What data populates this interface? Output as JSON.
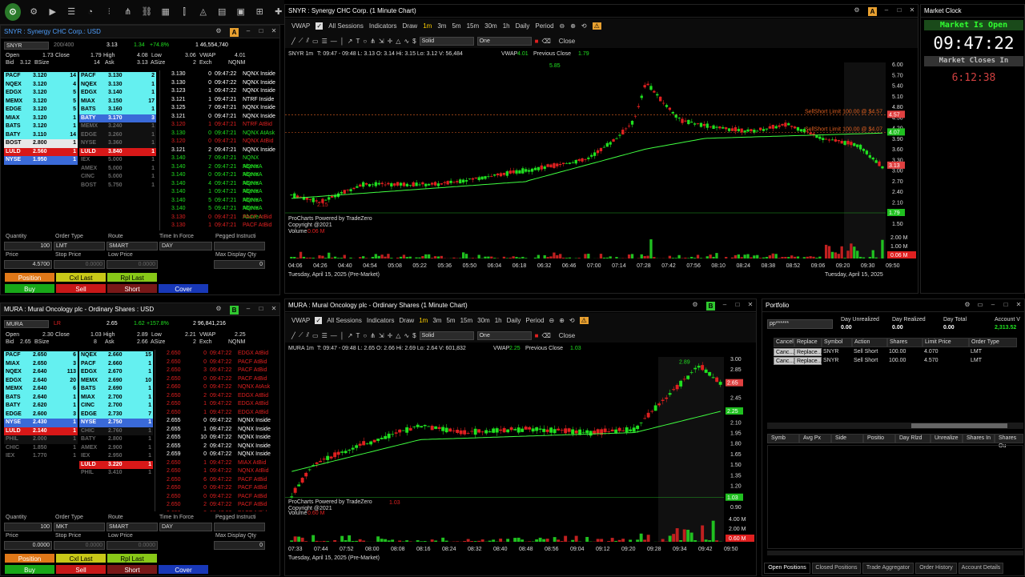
{
  "snyr_quote": {
    "title": "SNYR : Synergy CHC Corp.: USD",
    "symbol": "SNYR",
    "level_label": "200/400",
    "last": "3.13",
    "change": "1.34",
    "change_pct": "+74.8%",
    "volume": "1 46,554,740",
    "open_label": "Open",
    "open": "1.73",
    "close_label": "Close",
    "close": "1.79",
    "high_label": "High",
    "high": "4.08",
    "low_label": "Low",
    "low": "3.06",
    "vwap_label": "VWAP",
    "vwap": "4.01",
    "bid_label": "Bid",
    "bid": "3.12",
    "bsize_label": "BSize",
    "bsize": "14",
    "ask_label": "Ask",
    "ask": "3.13",
    "asize_label": "ASize",
    "asize": "2",
    "exch_label": "Exch",
    "exch": "NQNM",
    "bids": [
      {
        "mm": "PACF",
        "price": "3.120",
        "size": "14",
        "bg": "#64f0f0",
        "fg": "#000"
      },
      {
        "mm": "NQEX",
        "price": "3.120",
        "size": "4",
        "bg": "#64f0f0",
        "fg": "#000"
      },
      {
        "mm": "EDGX",
        "price": "3.120",
        "size": "5",
        "bg": "#64f0f0",
        "fg": "#000"
      },
      {
        "mm": "MEMX",
        "price": "3.120",
        "size": "5",
        "bg": "#64f0f0",
        "fg": "#000"
      },
      {
        "mm": "EDGE",
        "price": "3.120",
        "size": "5",
        "bg": "#64f0f0",
        "fg": "#000"
      },
      {
        "mm": "MIAX",
        "price": "3.120",
        "size": "1",
        "bg": "#64f0f0",
        "fg": "#000"
      },
      {
        "mm": "BATS",
        "price": "3.120",
        "size": "1",
        "bg": "#64f0f0",
        "fg": "#000"
      },
      {
        "mm": "BATY",
        "price": "3.110",
        "size": "14",
        "bg": "#64f0f0",
        "fg": "#000"
      },
      {
        "mm": "BOST",
        "price": "2.800",
        "size": "1",
        "bg": "#e8e8e8",
        "fg": "#000"
      },
      {
        "mm": "LULD",
        "price": "2.560",
        "size": "1",
        "bg": "#d81818",
        "fg": "#fff"
      },
      {
        "mm": "NYSE",
        "price": "1.950",
        "size": "1",
        "bg": "#3a6ad8",
        "fg": "#fff"
      }
    ],
    "asks": [
      {
        "mm": "PACF",
        "price": "3.130",
        "size": "2",
        "bg": "#64f0f0",
        "fg": "#000"
      },
      {
        "mm": "NQEX",
        "price": "3.130",
        "size": "1",
        "bg": "#64f0f0",
        "fg": "#000"
      },
      {
        "mm": "EDGX",
        "price": "3.140",
        "size": "1",
        "bg": "#64f0f0",
        "fg": "#000"
      },
      {
        "mm": "MIAX",
        "price": "3.150",
        "size": "17",
        "bg": "#64f0f0",
        "fg": "#000"
      },
      {
        "mm": "BATS",
        "price": "3.160",
        "size": "1",
        "bg": "#64f0f0",
        "fg": "#000"
      },
      {
        "mm": "BATY",
        "price": "3.170",
        "size": "3",
        "bg": "#3a6ad8",
        "fg": "#fff"
      },
      {
        "mm": "MEMX",
        "price": "3.240",
        "size": "1",
        "bg": "#111",
        "fg": "#666"
      },
      {
        "mm": "EDGE",
        "price": "3.260",
        "size": "1",
        "bg": "#111",
        "fg": "#666"
      },
      {
        "mm": "NYSE",
        "price": "3.360",
        "size": "1",
        "bg": "#111",
        "fg": "#666"
      },
      {
        "mm": "LULD",
        "price": "3.840",
        "size": "1",
        "bg": "#d81818",
        "fg": "#fff"
      },
      {
        "mm": "IEX",
        "price": "5.000",
        "size": "1",
        "bg": "#000",
        "fg": "#666"
      },
      {
        "mm": "AMEX",
        "price": "5.000",
        "size": "1",
        "bg": "#000",
        "fg": "#666"
      },
      {
        "mm": "CINC",
        "price": "5.000",
        "size": "1",
        "bg": "#000",
        "fg": "#666"
      },
      {
        "mm": "BOST",
        "price": "5.750",
        "size": "1",
        "bg": "#000",
        "fg": "#666"
      }
    ],
    "tas": [
      {
        "p": "3.130",
        "s": "0",
        "t": "09:47:22",
        "x": "NQNX Inside",
        "c": "#fff"
      },
      {
        "p": "3.130",
        "s": "0",
        "t": "09:47:22",
        "x": "NQNX Inside",
        "c": "#fff"
      },
      {
        "p": "3.123",
        "s": "1",
        "t": "09:47:22",
        "x": "NQNX Inside",
        "c": "#fff"
      },
      {
        "p": "3.121",
        "s": "1",
        "t": "09:47:21",
        "x": "NTRF Inside",
        "c": "#fff"
      },
      {
        "p": "3.125",
        "s": "7",
        "t": "09:47:21",
        "x": "NQNX Inside",
        "c": "#fff"
      },
      {
        "p": "3.121",
        "s": "0",
        "t": "09:47:21",
        "x": "NQNX Inside",
        "c": "#fff"
      },
      {
        "p": "3.120",
        "s": "1",
        "t": "09:47:21",
        "x": "NTRF AtBid",
        "c": "#e02020"
      },
      {
        "p": "3.130",
        "s": "0",
        "t": "09:47:21",
        "x": "NQNX AtAsk",
        "c": "#20e020"
      },
      {
        "p": "3.120",
        "s": "0",
        "t": "09:47:21",
        "x": "NQNX AtBid",
        "c": "#e02020"
      },
      {
        "p": "3.121",
        "s": "2",
        "t": "09:47:21",
        "x": "NQNX Inside",
        "c": "#fff"
      },
      {
        "p": "3.140",
        "s": "7",
        "t": "09:47:21",
        "x": "NQNX AboveA",
        "c": "#20e020"
      },
      {
        "p": "3.140",
        "s": "2",
        "t": "09:47:21",
        "x": "NQNX AboveA",
        "c": "#20e020"
      },
      {
        "p": "3.140",
        "s": "0",
        "t": "09:47:21",
        "x": "NQNX AboveA",
        "c": "#20e020"
      },
      {
        "p": "3.140",
        "s": "4",
        "t": "09:47:21",
        "x": "NQNX AboveA",
        "c": "#20e020"
      },
      {
        "p": "3.140",
        "s": "1",
        "t": "09:47:21",
        "x": "NQNX AboveA",
        "c": "#20e020"
      },
      {
        "p": "3.140",
        "s": "5",
        "t": "09:47:21",
        "x": "NQNX AboveA",
        "c": "#20e020"
      },
      {
        "p": "3.140",
        "s": "5",
        "t": "09:47:21",
        "x": "NQNX AboveA",
        "c": "#20e020"
      },
      {
        "p": "3.130",
        "s": "0",
        "t": "09:47:21",
        "x": "PACF AtBid",
        "c": "#e02020"
      },
      {
        "p": "3.130",
        "s": "1",
        "t": "09:47:21",
        "x": "PACF AtBid",
        "c": "#e02020"
      }
    ],
    "order": {
      "qty_label": "Quantity",
      "qty": "100",
      "otype_label": "Order Type",
      "otype": "LMT",
      "route_label": "Route",
      "route": "SMART",
      "tif_label": "Time In Force",
      "tif": "DAY",
      "pegged_label": "Pegged Instructi",
      "price_label": "Price",
      "price": "4.5700",
      "stop_label": "Stop Price",
      "stop": "0.0000",
      "low_label": "Low Price",
      "low": "0.0000",
      "maxdisp_label": "Max Display Qty",
      "maxdisp": "0"
    }
  },
  "mura_quote": {
    "title": "MURA : Mural Oncology plc - Ordinary Shares : USD",
    "symbol": "MURA",
    "level_label": "LR",
    "last": "2.65",
    "change": "1.62",
    "change_pct": "+157.8%",
    "volume": "2 96,841,216",
    "open_label": "Open",
    "open": "2.30",
    "close_label": "Close",
    "close": "1.03",
    "high_label": "High",
    "high": "2.89",
    "low_label": "Low",
    "low": "2.21",
    "vwap_label": "VWAP",
    "vwap": "2.25",
    "bid_label": "Bid",
    "bid": "2.65",
    "bsize_label": "BSize",
    "bsize": "8",
    "ask_label": "Ask",
    "ask": "2.66",
    "asize_label": "ASize",
    "asize": "2",
    "exch_label": "Exch",
    "exch": "NQNM",
    "bids": [
      {
        "mm": "PACF",
        "price": "2.650",
        "size": "6",
        "bg": "#64f0f0",
        "fg": "#000"
      },
      {
        "mm": "MIAX",
        "price": "2.650",
        "size": "3",
        "bg": "#64f0f0",
        "fg": "#000"
      },
      {
        "mm": "NQEX",
        "price": "2.640",
        "size": "113",
        "bg": "#64f0f0",
        "fg": "#000"
      },
      {
        "mm": "EDGX",
        "price": "2.640",
        "size": "20",
        "bg": "#64f0f0",
        "fg": "#000"
      },
      {
        "mm": "MEMX",
        "price": "2.640",
        "size": "6",
        "bg": "#64f0f0",
        "fg": "#000"
      },
      {
        "mm": "BATS",
        "price": "2.640",
        "size": "1",
        "bg": "#64f0f0",
        "fg": "#000"
      },
      {
        "mm": "BATY",
        "price": "2.620",
        "size": "1",
        "bg": "#64f0f0",
        "fg": "#000"
      },
      {
        "mm": "EDGE",
        "price": "2.600",
        "size": "3",
        "bg": "#64f0f0",
        "fg": "#000"
      },
      {
        "mm": "NYSE",
        "price": "2.430",
        "size": "1",
        "bg": "#3a6ad8",
        "fg": "#fff"
      },
      {
        "mm": "LULD",
        "price": "2.140",
        "size": "1",
        "bg": "#d81818",
        "fg": "#fff"
      },
      {
        "mm": "PHIL",
        "price": "2.000",
        "size": "1",
        "bg": "#111",
        "fg": "#666"
      },
      {
        "mm": "CHIC",
        "price": "1.850",
        "size": "1",
        "bg": "#000",
        "fg": "#666"
      },
      {
        "mm": "IEX",
        "price": "1.770",
        "size": "1",
        "bg": "#000",
        "fg": "#666"
      }
    ],
    "asks": [
      {
        "mm": "NQEX",
        "price": "2.660",
        "size": "15",
        "bg": "#64f0f0",
        "fg": "#000"
      },
      {
        "mm": "PACF",
        "price": "2.660",
        "size": "1",
        "bg": "#64f0f0",
        "fg": "#000"
      },
      {
        "mm": "EDGX",
        "price": "2.670",
        "size": "1",
        "bg": "#64f0f0",
        "fg": "#000"
      },
      {
        "mm": "MEMX",
        "price": "2.690",
        "size": "10",
        "bg": "#64f0f0",
        "fg": "#000"
      },
      {
        "mm": "BATS",
        "price": "2.690",
        "size": "1",
        "bg": "#64f0f0",
        "fg": "#000"
      },
      {
        "mm": "MIAX",
        "price": "2.700",
        "size": "1",
        "bg": "#64f0f0",
        "fg": "#000"
      },
      {
        "mm": "CINC",
        "price": "2.700",
        "size": "1",
        "bg": "#64f0f0",
        "fg": "#000"
      },
      {
        "mm": "EDGE",
        "price": "2.730",
        "size": "7",
        "bg": "#64f0f0",
        "fg": "#000"
      },
      {
        "mm": "NYSE",
        "price": "2.750",
        "size": "1",
        "bg": "#3a6ad8",
        "fg": "#fff"
      },
      {
        "mm": "CHIC",
        "price": "2.760",
        "size": "1",
        "bg": "#111",
        "fg": "#666"
      },
      {
        "mm": "BATY",
        "price": "2.800",
        "size": "1",
        "bg": "#000",
        "fg": "#666"
      },
      {
        "mm": "AMEX",
        "price": "2.900",
        "size": "1",
        "bg": "#000",
        "fg": "#666"
      },
      {
        "mm": "IEX",
        "price": "2.950",
        "size": "1",
        "bg": "#000",
        "fg": "#666"
      },
      {
        "mm": "LULD",
        "price": "3.220",
        "size": "1",
        "bg": "#d81818",
        "fg": "#fff"
      },
      {
        "mm": "PHIL",
        "price": "3.410",
        "size": "1",
        "bg": "#000",
        "fg": "#666"
      }
    ],
    "tas": [
      {
        "p": "2.650",
        "s": "0",
        "t": "09:47:22",
        "x": "EDGX AtBid",
        "c": "#e02020"
      },
      {
        "p": "2.650",
        "s": "0",
        "t": "09:47:22",
        "x": "PACF AtBid",
        "c": "#e02020"
      },
      {
        "p": "2.650",
        "s": "3",
        "t": "09:47:22",
        "x": "PACF AtBid",
        "c": "#e02020"
      },
      {
        "p": "2.650",
        "s": "0",
        "t": "09:47:22",
        "x": "PACF AtBid",
        "c": "#e02020"
      },
      {
        "p": "2.660",
        "s": "0",
        "t": "09:47:22",
        "x": "NQNX AtAsk",
        "c": "#e02020"
      },
      {
        "p": "2.650",
        "s": "2",
        "t": "09:47:22",
        "x": "EDGX AtBid",
        "c": "#e02020"
      },
      {
        "p": "2.650",
        "s": "1",
        "t": "09:47:22",
        "x": "EDGX AtBid",
        "c": "#e02020"
      },
      {
        "p": "2.650",
        "s": "1",
        "t": "09:47:22",
        "x": "EDGX AtBid",
        "c": "#e02020"
      },
      {
        "p": "2.655",
        "s": "0",
        "t": "09:47:22",
        "x": "NQNX Inside",
        "c": "#fff"
      },
      {
        "p": "2.655",
        "s": "1",
        "t": "09:47:22",
        "x": "NQNX Inside",
        "c": "#fff"
      },
      {
        "p": "2.655",
        "s": "10",
        "t": "09:47:22",
        "x": "NQNX Inside",
        "c": "#fff"
      },
      {
        "p": "2.655",
        "s": "2",
        "t": "09:47:22",
        "x": "NQNX Inside",
        "c": "#fff"
      },
      {
        "p": "2.659",
        "s": "0",
        "t": "09:47:22",
        "x": "NQNX Inside",
        "c": "#fff"
      },
      {
        "p": "2.650",
        "s": "1",
        "t": "09:47:22",
        "x": "MIAX AtBid",
        "c": "#e02020"
      },
      {
        "p": "2.650",
        "s": "1",
        "t": "09:47:22",
        "x": "NQNX AtBid",
        "c": "#e02020"
      },
      {
        "p": "2.650",
        "s": "6",
        "t": "09:47:22",
        "x": "PACF AtBid",
        "c": "#e02020"
      },
      {
        "p": "2.650",
        "s": "0",
        "t": "09:47:22",
        "x": "PACF AtBid",
        "c": "#e02020"
      },
      {
        "p": "2.650",
        "s": "0",
        "t": "09:47:22",
        "x": "PACF AtBid",
        "c": "#e02020"
      },
      {
        "p": "2.650",
        "s": "2",
        "t": "09:47:22",
        "x": "PACF AtBid",
        "c": "#e02020"
      },
      {
        "p": "2.650",
        "s": "3",
        "t": "09:47:22",
        "x": "PACF AtBid",
        "c": "#e02020"
      }
    ],
    "order": {
      "qty_label": "Quantity",
      "qty": "100",
      "otype_label": "Order Type",
      "otype": "MKT",
      "route_label": "Route",
      "route": "SMART",
      "tif_label": "Time In Force",
      "tif": "DAY",
      "pegged_label": "Pegged Instructi",
      "price_label": "Price",
      "price": "0.0000",
      "stop_label": "Stop Price",
      "stop": "0.0000",
      "low_label": "Low Price",
      "low": "0.0000",
      "maxdisp_label": "Max Display Qty",
      "maxdisp": "0"
    }
  },
  "buttons": {
    "position": "Position",
    "cxl_last": "Cxl Last",
    "rpl_last": "Rpl Last",
    "buy": "Buy",
    "sell": "Sell",
    "short": "Short",
    "cover": "Cover"
  },
  "chart_toolbar": {
    "vwap": "VWAP",
    "all_sessions": "All Sessions",
    "indicators": "Indicators",
    "timeframes": [
      "1m",
      "3m",
      "5m",
      "15m",
      "30m",
      "1h",
      "Daily"
    ],
    "period": "Period",
    "draw": "Draw",
    "line_style": "Solid",
    "line_width": "One",
    "close": "Close"
  },
  "snyr_chart": {
    "title": "SNYR : Synergy CHC Corp. (1 Minute Chart)",
    "info_sym": "SNYR 1m",
    "info_ohlc": "T: 09:47 - 09:48  L: 3.13  O: 3.14  Hi: 3.15  Lo: 3.12  V: 56,484",
    "info_vwap_label": "VWAP",
    "info_vwap": "4.01",
    "info_prev_label": "Previous Close",
    "info_prev": "1.79",
    "order_line_1": "SellShort Limit 100.00 @ $4.57",
    "order_line_2": "SellShort Limit 100.00 @ $4.07",
    "high_marker": "5.85",
    "powered": "ProCharts Powered by TradeZero",
    "copyright": "Copyright @2021",
    "volume_label": "Volume",
    "volume_value": "0.06 M",
    "date": "Tuesday, April 15, 2025 (Pre-Market)",
    "date_right": "Tuesday, April 15, 2025",
    "y_ticks": [
      "6.00",
      "5.70",
      "5.40",
      "5.10",
      "4.80",
      "4.50",
      "4.20",
      "3.90",
      "3.60",
      "3.30",
      "3.00",
      "2.70",
      "2.40",
      "2.10",
      "1.80",
      "1.50"
    ],
    "x_ticks": [
      "04:06",
      "04:26",
      "04:40",
      "04:54",
      "05:08",
      "05:22",
      "05:36",
      "05:50",
      "06:04",
      "06:18",
      "06:32",
      "06:46",
      "07:00",
      "07:14",
      "07:28",
      "07:42",
      "07:56",
      "08:10",
      "08:24",
      "08:38",
      "08:52",
      "09:06",
      "09:20",
      "09:30",
      "09:50"
    ],
    "price_tags": [
      "4.57",
      "4.07",
      "3.13",
      "1.79"
    ],
    "vol_ticks": [
      "2.00 M",
      "1.00 M",
      "0.06 M"
    ],
    "bot_marker": "2.15"
  },
  "mura_chart": {
    "title": "MURA : Mural Oncology plc - Ordinary Shares (1 Minute Chart)",
    "info_sym": "MURA 1m",
    "info_ohlc": "T: 09:47 - 09:48  L: 2.65  O: 2.66  Hi: 2.69  Lo: 2.64  V: 601,832",
    "info_vwap_label": "VWAP",
    "info_vwap": "2.25",
    "info_prev_label": "Previous Close",
    "info_prev": "1.03",
    "high_marker": "2.89",
    "bot_marker": "1.03",
    "powered": "ProCharts Powered by TradeZero",
    "copyright": "Copyright @2021",
    "volume_label": "Volume",
    "volume_value": "0.60 M",
    "date": "Tuesday, April 15, 2025 (Pre-Market)",
    "y_ticks": [
      "3.00",
      "2.85",
      "2.65",
      "2.45",
      "2.25",
      "2.10",
      "1.95",
      "1.80",
      "1.65",
      "1.50",
      "1.35",
      "1.20",
      "1.05",
      "0.90"
    ],
    "x_ticks": [
      "07:33",
      "07:44",
      "07:52",
      "08:00",
      "08:08",
      "08:16",
      "08:24",
      "08:32",
      "08:40",
      "08:48",
      "08:56",
      "09:04",
      "09:12",
      "09:20",
      "09:28",
      "09:34",
      "09:42",
      "09:50"
    ],
    "price_tags": [
      "2.65",
      "2.25",
      "1.03"
    ],
    "vol_ticks": [
      "4.00 M",
      "2.00 M",
      "0.60 M"
    ]
  },
  "market_clock": {
    "title": "Market Clock",
    "status": "Market Is Open",
    "time": "09:47:22",
    "closes_label": "Market Closes In",
    "countdown": "6:12:38"
  },
  "portfolio": {
    "title": "Portfolio",
    "account": "pp******",
    "day_unrealized_label": "Day Unrealized",
    "day_unrealized": "0.00",
    "day_realized_label": "Day Realized",
    "day_realized": "0.00",
    "day_total_label": "Day Total",
    "day_total": "0.00",
    "account_value_label": "Account V",
    "account_value": "2,313.52",
    "order_headers": [
      "Cancel",
      "Replace",
      "Symbol",
      "Action",
      "Shares",
      "Limit Price",
      "Order Type"
    ],
    "orders": [
      {
        "cancel": "Canc...",
        "replace": "Replace...",
        "symbol": "SNYR",
        "action": "Sell Short",
        "shares": "100.00",
        "limit": "4.070",
        "type": "LMT"
      },
      {
        "cancel": "Canc...",
        "replace": "Replace...",
        "symbol": "SNYR",
        "action": "Sell Short",
        "shares": "100.00",
        "limit": "4.570",
        "type": "LMT"
      }
    ],
    "pos_headers": [
      "Symb",
      "Avg Px",
      "Side",
      "Positio",
      "Day Rlzd",
      "Unrealize",
      "Shares In",
      "Shares Ou"
    ],
    "tabs": [
      "Open Positions",
      "Closed Positions",
      "Trade Aggregator",
      "Order History",
      "Account Details"
    ]
  }
}
